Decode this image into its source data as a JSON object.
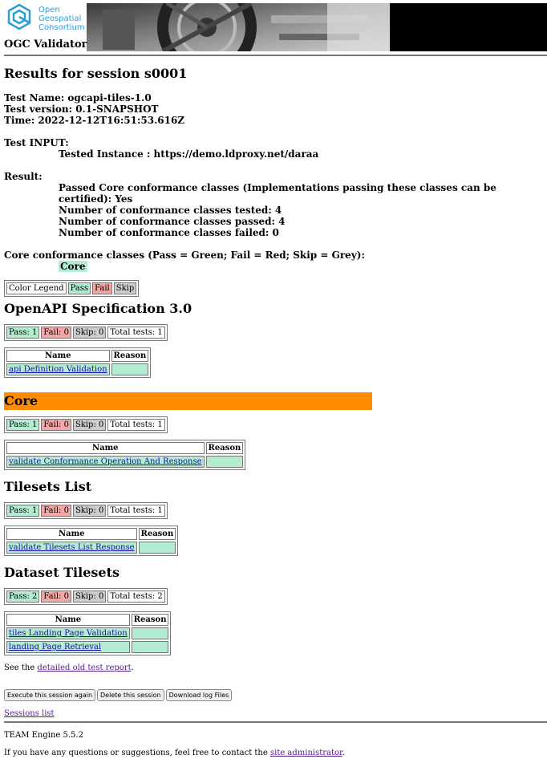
{
  "header": {
    "org_lines": [
      "Open",
      "Geospatial",
      "Consortium"
    ],
    "app_title": "OGC Validator"
  },
  "results": {
    "title": "Results for session s0001",
    "test_name": "Test Name: ogcapi-tiles-1.0",
    "test_version": "Test version: 0.1-SNAPSHOT",
    "time": "Time: 2022-12-12T16:51:53.616Z",
    "input_label": "Test INPUT:",
    "tested_instance": "Tested Instance : https://demo.ldproxy.net/daraa",
    "result_label": "Result:",
    "result_lines": [
      "Passed Core conformance classes (Implementations passing these classes can be certified): Yes",
      "Number of conformance classes tested: 4",
      "Number of conformance classes passed: 4",
      "Number of conformance classes failed: 0"
    ],
    "core_classes_label": "Core conformance classes (Pass = Green; Fail = Red; Skip = Grey):",
    "core_class": "Core"
  },
  "legend": {
    "label": "Color Legend",
    "pass": "Pass",
    "fail": "Fail",
    "skip": "Skip"
  },
  "table_headers": {
    "name": "Name",
    "reason": "Reason"
  },
  "sections": [
    {
      "title": "OpenAPI Specification 3.0",
      "pass": "Pass: 1",
      "fail": "Fail: 0",
      "skip": "Skip: 0",
      "total": "Total tests: 1",
      "tests": [
        "api Definition Validation"
      ]
    },
    {
      "title": "Core",
      "pass": "Pass: 1",
      "fail": "Fail: 0",
      "skip": "Skip: 0",
      "total": "Total tests: 1",
      "tests": [
        "validate Conformance Operation And Response"
      ]
    },
    {
      "title": "Tilesets List",
      "pass": "Pass: 1",
      "fail": "Fail: 0",
      "skip": "Skip: 0",
      "total": "Total tests: 1",
      "tests": [
        "validate Tilesets List Response"
      ]
    },
    {
      "title": "Dataset Tilesets",
      "pass": "Pass: 2",
      "fail": "Fail: 0",
      "skip": "Skip: 0",
      "total": "Total tests: 2",
      "tests": [
        "tiles Landing Page Validation",
        "landing Page Retrieval"
      ]
    }
  ],
  "report": {
    "prefix": "See the ",
    "link": "detailed old test report",
    "suffix": "."
  },
  "buttons": {
    "execute": "Execute this session again",
    "delete": "Delete this session",
    "download": "Download log Files"
  },
  "sessions_link": "Sessions list",
  "footer": {
    "version": "TEAM Engine 5.5.2",
    "contact_prefix": "If you have any questions or suggestions, feel free to contact the ",
    "contact_link": "site administrator",
    "contact_suffix": "."
  }
}
